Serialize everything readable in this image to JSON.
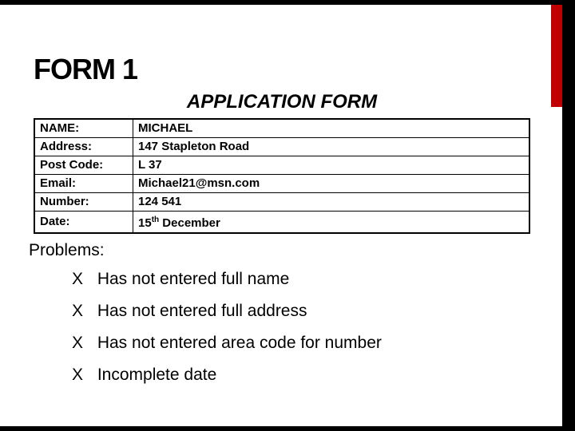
{
  "heading": "FORM 1",
  "form_title": "APPLICATION FORM",
  "fields": [
    {
      "label": "NAME:",
      "value": "MICHAEL"
    },
    {
      "label": "Address:",
      "value": "147 Stapleton Road"
    },
    {
      "label": "Post Code:",
      "value": "L 37"
    },
    {
      "label": "Email:",
      "value": "Michael21@msn.com"
    },
    {
      "label": "Number:",
      "value": "124 541"
    },
    {
      "label": "Date:",
      "value_html": "15<span class=\"sup\">th</span> December"
    }
  ],
  "problems_heading": "Problems:",
  "problem_mark": "X",
  "problems": [
    "Has not entered full name",
    "Has not entered full address",
    "Has not entered area code for number",
    "Incomplete date"
  ]
}
